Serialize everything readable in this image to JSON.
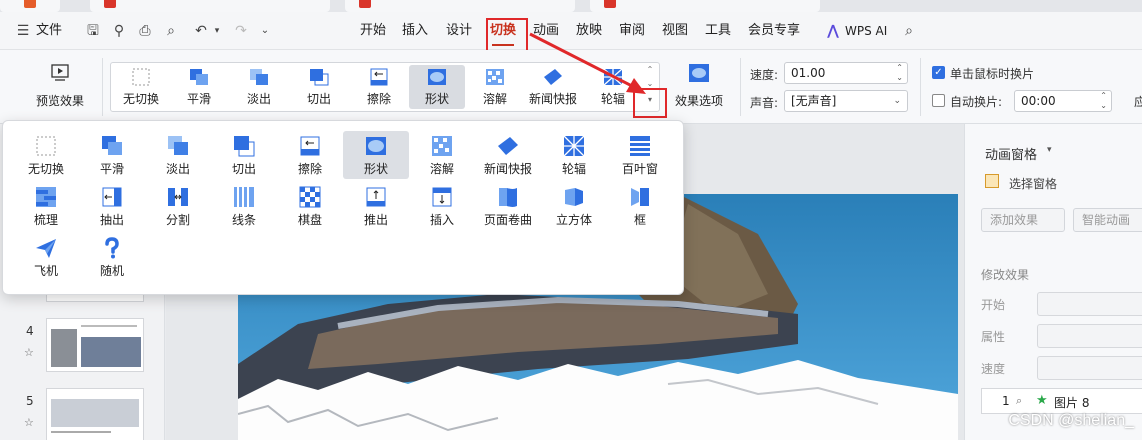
{
  "menu": {
    "file": "文件",
    "tabs": [
      "开始",
      "插入",
      "设计",
      "切换",
      "动画",
      "放映",
      "审阅",
      "视图",
      "工具",
      "会员专享"
    ],
    "active_tab": "切换",
    "wps_ai": "WPS AI"
  },
  "ribbon": {
    "preview": "预览效果",
    "effect_options": "效果选项",
    "gallery": [
      "无切换",
      "平滑",
      "淡出",
      "切出",
      "擦除",
      "形状",
      "溶解",
      "新闻快报",
      "轮辐"
    ],
    "selected": "形状",
    "speed_label": "速度:",
    "speed_value": "01.00",
    "sound_label": "声音:",
    "sound_value": "[无声音]",
    "click_advance": "单击鼠标时换片",
    "auto_advance": "自动换片:",
    "auto_time": "00:00",
    "cut_label": "应"
  },
  "dropdown": {
    "rows": [
      [
        "无切换",
        "平滑",
        "淡出",
        "切出",
        "擦除",
        "形状",
        "溶解",
        "新闻快报",
        "轮辐",
        "百叶窗"
      ],
      [
        "梳理",
        "抽出",
        "分割",
        "线条",
        "棋盘",
        "推出",
        "插入",
        "页面卷曲",
        "立方体",
        "框"
      ],
      [
        "飞机",
        "随机"
      ]
    ],
    "selected": "形状"
  },
  "thumbnails": [
    {
      "num": "4"
    },
    {
      "num": "5"
    }
  ],
  "right_pane": {
    "title": "动画窗格",
    "select_pane": "选择窗格",
    "add_effect": "添加效果",
    "smart_anim": "智能动画",
    "modify": "修改效果",
    "start": "开始",
    "property": "属性",
    "speed": "速度",
    "list_item_num": "1",
    "list_item_name": "图片 8"
  },
  "watermark": "CSDN @shelian_",
  "colors": {
    "accent": "#c8321e",
    "annotation_red": "#e0282a",
    "icon_blue": "#2f6fe0",
    "sea": "#2a7fb8"
  }
}
